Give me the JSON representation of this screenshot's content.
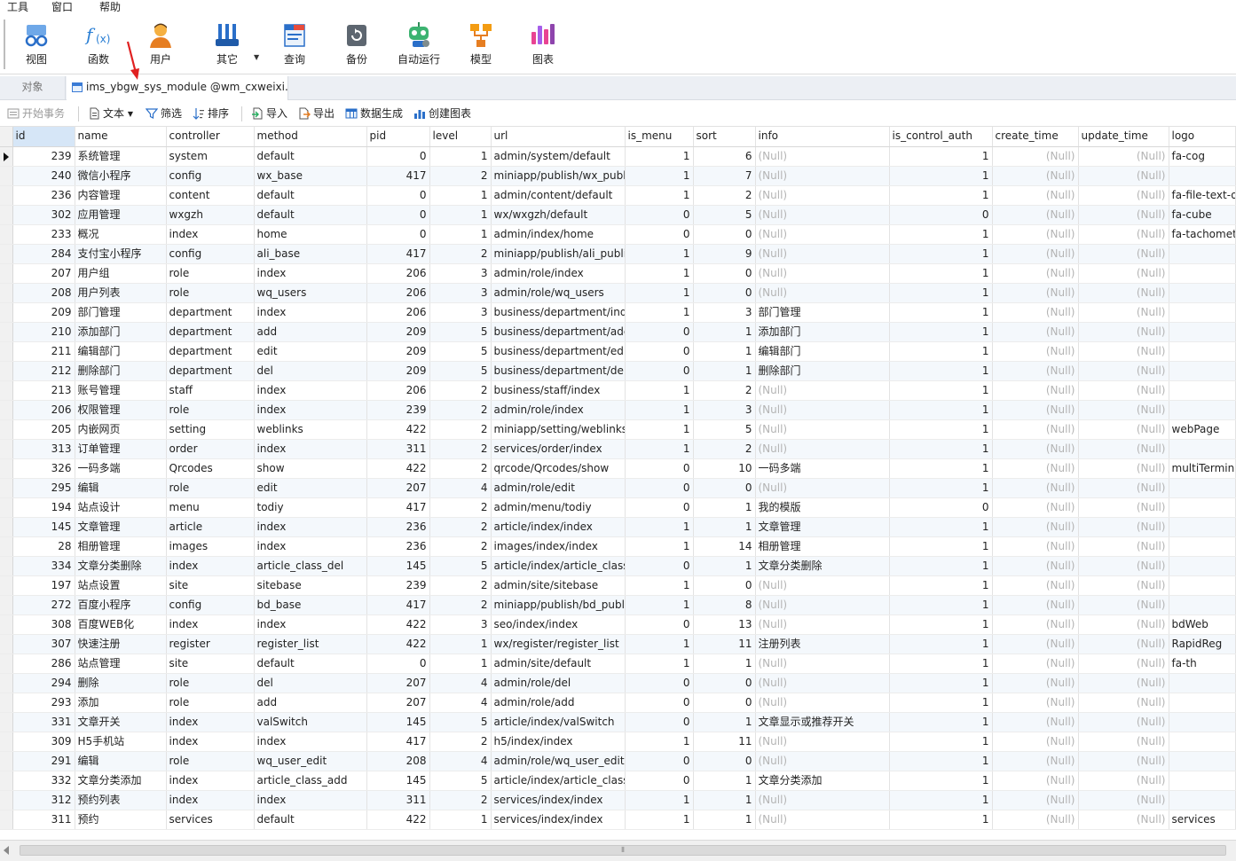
{
  "menu": [
    "工具",
    "窗口",
    "帮助"
  ],
  "ribbon": [
    {
      "label": "视图",
      "icon": "view-icon"
    },
    {
      "label": "函数",
      "icon": "function-icon"
    },
    {
      "label": "用户",
      "icon": "user-icon"
    },
    {
      "label": "其它",
      "icon": "tools-icon"
    },
    {
      "label": "查询",
      "icon": "query-icon"
    },
    {
      "label": "备份",
      "icon": "backup-icon"
    },
    {
      "label": "自动运行",
      "icon": "robot-icon"
    },
    {
      "label": "模型",
      "icon": "model-icon"
    },
    {
      "label": "图表",
      "icon": "chart-icon"
    }
  ],
  "tabs": {
    "objects": "对象",
    "table": "ims_ybgw_sys_module @wm_cxweixi..."
  },
  "grid_toolbar": {
    "begin_transaction": "开始事务",
    "text": "文本",
    "filter": "筛选",
    "sort": "排序",
    "import": "导入",
    "export": "导出",
    "data_generation": "数据生成",
    "create_chart": "创建图表"
  },
  "columns": [
    "id",
    "name",
    "controller",
    "method",
    "pid",
    "level",
    "url",
    "is_menu",
    "sort",
    "info",
    "is_control_auth",
    "create_time",
    "update_time",
    "logo"
  ],
  "rows": [
    [
      "239",
      "系统管理",
      "system",
      "default",
      "0",
      "1",
      "admin/system/default",
      "1",
      "6",
      "(Null)",
      "1",
      "(Null)",
      "(Null)",
      "fa-cog"
    ],
    [
      "240",
      "微信小程序",
      "config",
      "wx_base",
      "417",
      "2",
      "miniapp/publish/wx_publi",
      "1",
      "7",
      "(Null)",
      "1",
      "(Null)",
      "(Null)",
      ""
    ],
    [
      "236",
      "内容管理",
      "content",
      "default",
      "0",
      "1",
      "admin/content/default",
      "1",
      "2",
      "(Null)",
      "1",
      "(Null)",
      "(Null)",
      "fa-file-text-o"
    ],
    [
      "302",
      "应用管理",
      "wxgzh",
      "default",
      "0",
      "1",
      "wx/wxgzh/default",
      "0",
      "5",
      "(Null)",
      "0",
      "(Null)",
      "(Null)",
      "fa-cube"
    ],
    [
      "233",
      "概况",
      "index",
      "home",
      "0",
      "1",
      "admin/index/home",
      "0",
      "0",
      "(Null)",
      "1",
      "(Null)",
      "(Null)",
      "fa-tachometer"
    ],
    [
      "284",
      "支付宝小程序",
      "config",
      "ali_base",
      "417",
      "2",
      "miniapp/publish/ali_publis",
      "1",
      "9",
      "(Null)",
      "1",
      "(Null)",
      "(Null)",
      ""
    ],
    [
      "207",
      "用户组",
      "role",
      "index",
      "206",
      "3",
      "admin/role/index",
      "1",
      "0",
      "(Null)",
      "1",
      "(Null)",
      "(Null)",
      ""
    ],
    [
      "208",
      "用户列表",
      "role",
      "wq_users",
      "206",
      "3",
      "admin/role/wq_users",
      "1",
      "0",
      "(Null)",
      "1",
      "(Null)",
      "(Null)",
      ""
    ],
    [
      "209",
      "部门管理",
      "department",
      "index",
      "206",
      "3",
      "business/department/inde",
      "1",
      "3",
      "部门管理",
      "1",
      "(Null)",
      "(Null)",
      ""
    ],
    [
      "210",
      "添加部门",
      "department",
      "add",
      "209",
      "5",
      "business/department/adc",
      "0",
      "1",
      "添加部门",
      "1",
      "(Null)",
      "(Null)",
      ""
    ],
    [
      "211",
      "编辑部门",
      "department",
      "edit",
      "209",
      "5",
      "business/department/edit",
      "0",
      "1",
      "编辑部门",
      "1",
      "(Null)",
      "(Null)",
      ""
    ],
    [
      "212",
      "删除部门",
      "department",
      "del",
      "209",
      "5",
      "business/department/del",
      "0",
      "1",
      "删除部门",
      "1",
      "(Null)",
      "(Null)",
      ""
    ],
    [
      "213",
      "账号管理",
      "staff",
      "index",
      "206",
      "2",
      "business/staff/index",
      "1",
      "2",
      "(Null)",
      "1",
      "(Null)",
      "(Null)",
      ""
    ],
    [
      "206",
      "权限管理",
      "role",
      "index",
      "239",
      "2",
      "admin/role/index",
      "1",
      "3",
      "(Null)",
      "1",
      "(Null)",
      "(Null)",
      ""
    ],
    [
      "205",
      "内嵌网页",
      "setting",
      "weblinks",
      "422",
      "2",
      "miniapp/setting/weblinks",
      "1",
      "5",
      "(Null)",
      "1",
      "(Null)",
      "(Null)",
      "webPage"
    ],
    [
      "313",
      "订单管理",
      "order",
      "index",
      "311",
      "2",
      "services/order/index",
      "1",
      "2",
      "(Null)",
      "1",
      "(Null)",
      "(Null)",
      ""
    ],
    [
      "326",
      "一码多端",
      "Qrcodes",
      "show",
      "422",
      "2",
      "qrcode/Qrcodes/show",
      "0",
      "10",
      "一码多端",
      "1",
      "(Null)",
      "(Null)",
      "multiTermina"
    ],
    [
      "295",
      "编辑",
      "role",
      "edit",
      "207",
      "4",
      "admin/role/edit",
      "0",
      "0",
      "(Null)",
      "1",
      "(Null)",
      "(Null)",
      ""
    ],
    [
      "194",
      "站点设计",
      "menu",
      "todiy",
      "417",
      "2",
      "admin/menu/todiy",
      "0",
      "1",
      "我的模版",
      "0",
      "(Null)",
      "(Null)",
      ""
    ],
    [
      "145",
      "文章管理",
      "article",
      "index",
      "236",
      "2",
      "article/index/index",
      "1",
      "1",
      "文章管理",
      "1",
      "(Null)",
      "(Null)",
      ""
    ],
    [
      "28",
      "相册管理",
      "images",
      "index",
      "236",
      "2",
      "images/index/index",
      "1",
      "14",
      "相册管理",
      "1",
      "(Null)",
      "(Null)",
      ""
    ],
    [
      "334",
      "文章分类删除",
      "index",
      "article_class_del",
      "145",
      "5",
      "article/index/article_class_",
      "0",
      "1",
      "文章分类删除",
      "1",
      "(Null)",
      "(Null)",
      ""
    ],
    [
      "197",
      "站点设置",
      "site",
      "sitebase",
      "239",
      "2",
      "admin/site/sitebase",
      "1",
      "0",
      "(Null)",
      "1",
      "(Null)",
      "(Null)",
      ""
    ],
    [
      "272",
      "百度小程序",
      "config",
      "bd_base",
      "417",
      "2",
      "miniapp/publish/bd_publi",
      "1",
      "8",
      "(Null)",
      "1",
      "(Null)",
      "(Null)",
      ""
    ],
    [
      "308",
      "百度WEB化",
      "index",
      "index",
      "422",
      "3",
      "seo/index/index",
      "0",
      "13",
      "(Null)",
      "1",
      "(Null)",
      "(Null)",
      "bdWeb"
    ],
    [
      "307",
      "快速注册",
      "register",
      "register_list",
      "422",
      "1",
      "wx/register/register_list",
      "1",
      "11",
      "注册列表",
      "1",
      "(Null)",
      "(Null)",
      "RapidReg"
    ],
    [
      "286",
      "站点管理",
      "site",
      "default",
      "0",
      "1",
      "admin/site/default",
      "1",
      "1",
      "(Null)",
      "1",
      "(Null)",
      "(Null)",
      "fa-th"
    ],
    [
      "294",
      "删除",
      "role",
      "del",
      "207",
      "4",
      "admin/role/del",
      "0",
      "0",
      "(Null)",
      "1",
      "(Null)",
      "(Null)",
      ""
    ],
    [
      "293",
      "添加",
      "role",
      "add",
      "207",
      "4",
      "admin/role/add",
      "0",
      "0",
      "(Null)",
      "1",
      "(Null)",
      "(Null)",
      ""
    ],
    [
      "331",
      "文章开关",
      "index",
      "valSwitch",
      "145",
      "5",
      "article/index/valSwitch",
      "0",
      "1",
      "文章显示或推荐开关",
      "1",
      "(Null)",
      "(Null)",
      ""
    ],
    [
      "309",
      "H5手机站",
      "index",
      "index",
      "417",
      "2",
      "h5/index/index",
      "1",
      "11",
      "(Null)",
      "1",
      "(Null)",
      "(Null)",
      ""
    ],
    [
      "291",
      "编辑",
      "role",
      "wq_user_edit",
      "208",
      "4",
      "admin/role/wq_user_edit",
      "0",
      "0",
      "(Null)",
      "1",
      "(Null)",
      "(Null)",
      ""
    ],
    [
      "332",
      "文章分类添加",
      "index",
      "article_class_add",
      "145",
      "5",
      "article/index/article_class_",
      "0",
      "1",
      "文章分类添加",
      "1",
      "(Null)",
      "(Null)",
      ""
    ],
    [
      "312",
      "预约列表",
      "index",
      "index",
      "311",
      "2",
      "services/index/index",
      "1",
      "1",
      "(Null)",
      "1",
      "(Null)",
      "(Null)",
      ""
    ],
    [
      "311",
      "预约",
      "services",
      "default",
      "422",
      "1",
      "services/index/index",
      "1",
      "1",
      "(Null)",
      "1",
      "(Null)",
      "(Null)",
      "services"
    ]
  ],
  "colors": {
    "selected_header": "#d6e6f7",
    "alt_row": "#f4f8fc",
    "null_text": "#b4b4b4",
    "annotation_arrow": "#e02020"
  }
}
